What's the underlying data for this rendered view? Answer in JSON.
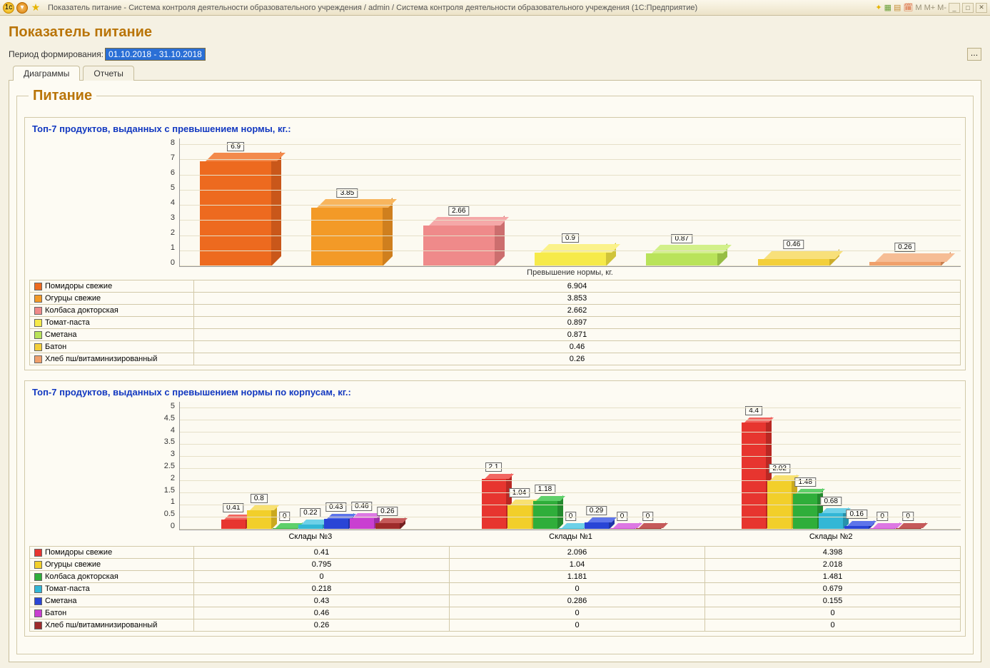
{
  "titlebar": {
    "text": "Показатель питание - Система контроля деятельности образовательного учреждения / admin / Система контроля деятельности образовательного учреждения  (1С:Предприятие)"
  },
  "page_title": "Показатель питание",
  "period_label": "Период формирования:",
  "period_value": "01.10.2018 - 31.10.2018",
  "tabs": {
    "diagrams": "Диаграммы",
    "reports": "Отчеты"
  },
  "group_title": "Питание",
  "chart_data": [
    {
      "id": "chart1",
      "type": "bar",
      "title": "Топ-7 продуктов, выданных с превышением нормы, кг.:",
      "xlabel": "Превышение нормы, кг.",
      "ylim": [
        0,
        8
      ],
      "yticks": [
        0,
        1,
        2,
        3,
        4,
        5,
        6,
        7,
        8
      ],
      "series_name": "Превышение нормы, кг.",
      "categories": [
        "Помидоры свежие",
        "Огурцы свежие",
        "Колбаса докторская",
        "Томат-паста",
        "Сметана",
        "Батон",
        "Хлеб пш/витаминизированный"
      ],
      "bar_labels": [
        "6.9",
        "3.85",
        "2.66",
        "0.9",
        "0.87",
        "0.46",
        "0.26"
      ],
      "values": [
        6.904,
        3.853,
        2.662,
        0.897,
        0.871,
        0.46,
        0.26
      ],
      "table_values": [
        "6.904",
        "3.853",
        "2.662",
        "0.897",
        "0.871",
        "0.46",
        "0.26"
      ]
    },
    {
      "id": "chart2",
      "type": "bar",
      "title": "Топ-7 продуктов, выданных с превышением нормы по корпусам, кг.:",
      "ylim": [
        0,
        5
      ],
      "yticks": [
        0,
        0.5,
        1,
        1.5,
        2,
        2.5,
        3,
        3.5,
        4,
        4.5,
        5
      ],
      "group_labels": [
        "Склады №3",
        "Склады №1",
        "Склады №2"
      ],
      "series": [
        {
          "name": "Помидоры свежие",
          "values": [
            0.41,
            2.096,
            4.398
          ],
          "bar_labels": [
            "0.41",
            "2.1",
            "4.4"
          ]
        },
        {
          "name": "Огурцы свежие",
          "values": [
            0.795,
            1.04,
            2.018
          ],
          "bar_labels": [
            "0.8",
            "1.04",
            "2.02"
          ]
        },
        {
          "name": "Колбаса докторская",
          "values": [
            0,
            1.181,
            1.481
          ],
          "bar_labels": [
            "0",
            "1.18",
            "1.48"
          ]
        },
        {
          "name": "Томат-паста",
          "values": [
            0.218,
            0,
            0.679
          ],
          "bar_labels": [
            "0.22",
            "0",
            "0.68"
          ]
        },
        {
          "name": "Сметана",
          "values": [
            0.43,
            0.286,
            0.155
          ],
          "bar_labels": [
            "0.43",
            "0.29",
            "0.16"
          ]
        },
        {
          "name": "Батон",
          "values": [
            0.46,
            0,
            0
          ],
          "bar_labels": [
            "0.46",
            "0",
            "0"
          ]
        },
        {
          "name": "Хлеб пш/витаминизированный",
          "values": [
            0.26,
            0,
            0
          ],
          "bar_labels": [
            "0.26",
            "0",
            "0"
          ]
        }
      ],
      "table": [
        {
          "name": "Помидоры свежие",
          "vals": [
            "0.41",
            "2.096",
            "4.398"
          ]
        },
        {
          "name": "Огурцы свежие",
          "vals": [
            "0.795",
            "1.04",
            "2.018"
          ]
        },
        {
          "name": "Колбаса докторская",
          "vals": [
            "0",
            "1.181",
            "1.481"
          ]
        },
        {
          "name": "Томат-паста",
          "vals": [
            "0.218",
            "0",
            "0.679"
          ]
        },
        {
          "name": "Сметана",
          "vals": [
            "0.43",
            "0.286",
            "0.155"
          ]
        },
        {
          "name": "Батон",
          "vals": [
            "0.46",
            "0",
            "0"
          ]
        },
        {
          "name": "Хлеб пш/витаминизированный",
          "vals": [
            "0.26",
            "0",
            "0"
          ]
        }
      ]
    }
  ]
}
